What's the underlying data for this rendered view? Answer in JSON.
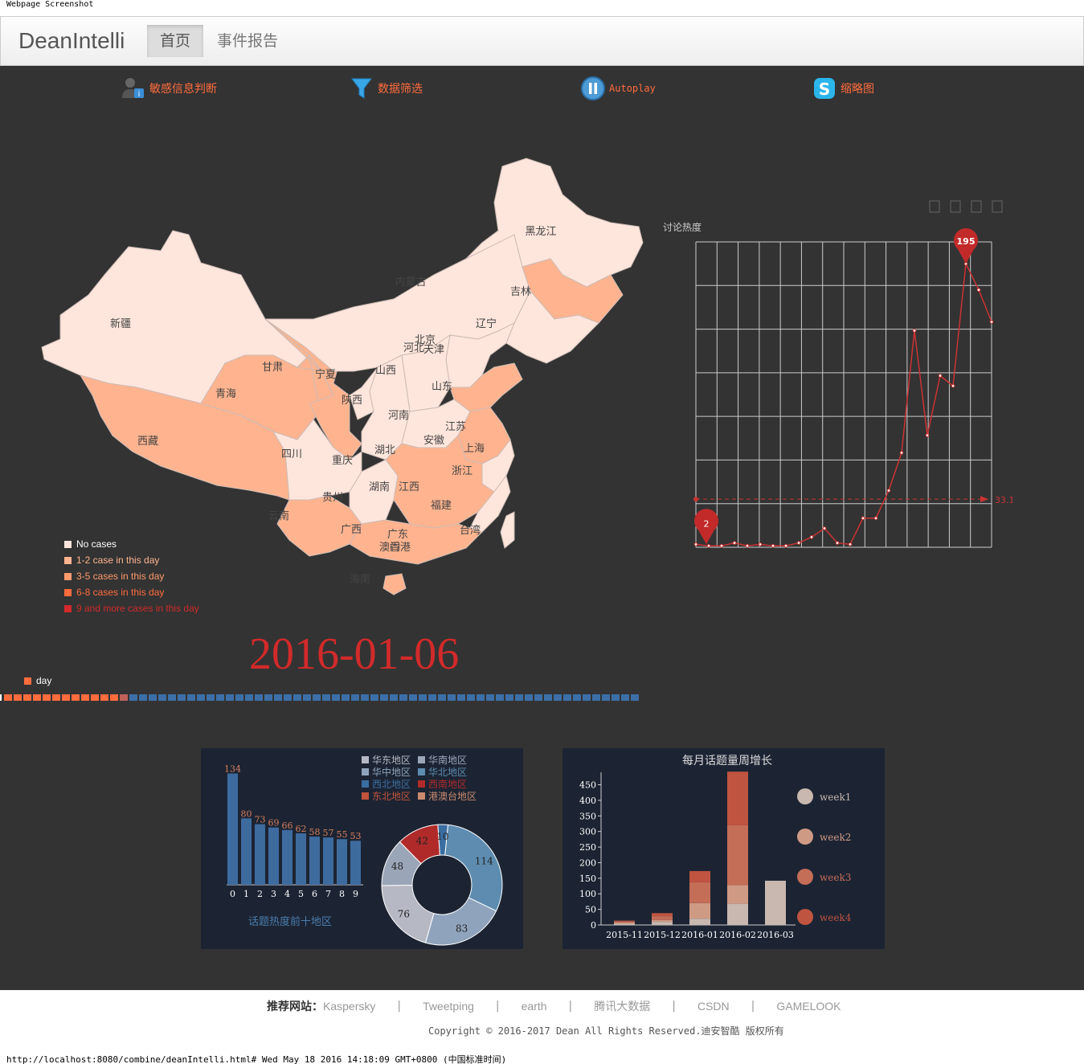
{
  "print_header": "Webpage Screenshot",
  "navbar": {
    "brand": "DeanIntelli",
    "links": [
      "首页",
      "事件报告"
    ]
  },
  "toolbar": [
    {
      "label": "敏感信息判断",
      "icon": "user-info-icon"
    },
    {
      "label": "数据筛选",
      "icon": "filter-icon"
    },
    {
      "label": "Autoplay",
      "icon": "pause-icon"
    },
    {
      "label": "缩略图",
      "icon": "skype-icon"
    }
  ],
  "map": {
    "legend": [
      {
        "label": "No cases",
        "color": "#ffe6dc",
        "text_color": "#ffffff"
      },
      {
        "label": "1-2 case in this day",
        "color": "#ffb48f",
        "text_color": "#ffb48f"
      },
      {
        "label": "3-5 cases in this day",
        "color": "#ff9a6c",
        "text_color": "#ff9a6c"
      },
      {
        "label": "6-8 cases in this day",
        "color": "#ff6c3d",
        "text_color": "#ff6c3d"
      },
      {
        "label": "9 and more cases in this day",
        "color": "#d22a2a",
        "text_color": "#d22a2a"
      }
    ],
    "provinces": [
      "黑龙江",
      "吉林",
      "辽宁",
      "内蒙古",
      "新疆",
      "北京",
      "天津",
      "河北",
      "山西",
      "山东",
      "甘肃",
      "宁夏",
      "陕西",
      "青海",
      "河南",
      "江苏",
      "安徽",
      "上海",
      "西藏",
      "四川",
      "湖北",
      "重庆",
      "浙江",
      "湖南",
      "江西",
      "贵州",
      "福建",
      "云南",
      "广西",
      "广东",
      "台湾",
      "香港",
      "澳门",
      "海南"
    ],
    "date": "2016-01-06"
  },
  "timeline": {
    "legend": "day",
    "played_color": "#ff6c3d",
    "current_color": "#c0625a",
    "remaining_color": "#3c6fa8",
    "played": 12,
    "total": 66
  },
  "line_chart": {
    "title": "讨论热度",
    "toolbox": [
      "data-view-icon",
      "line-icon",
      "bar-icon",
      "restore-icon",
      "save-image-icon"
    ],
    "values": [
      2,
      1,
      1,
      3,
      1,
      2,
      1,
      1,
      3,
      7,
      13,
      3,
      2,
      20,
      20,
      39,
      65,
      149,
      77,
      118,
      111,
      195,
      177,
      155
    ],
    "max_label": "195",
    "min_label": "2",
    "avg_label": "33.11",
    "ylim": [
      0,
      210
    ]
  },
  "bar_panel": {
    "title": "话题热度前十地区",
    "categories": [
      "0",
      "1",
      "2",
      "3",
      "4",
      "5",
      "6",
      "7",
      "8",
      "9"
    ],
    "values": [
      134,
      80,
      73,
      69,
      66,
      62,
      58,
      57,
      55,
      53
    ],
    "legend": [
      {
        "label": "华东地区",
        "color": "#b6b8c4"
      },
      {
        "label": "华南地区",
        "color": "#9aa5b8"
      },
      {
        "label": "华中地区",
        "color": "#8fa4bc"
      },
      {
        "label": "华北地区",
        "color": "#5d8cb0"
      },
      {
        "label": "西北地区",
        "color": "#3b6ea0"
      },
      {
        "label": "西南地区",
        "color": "#b02a2a"
      },
      {
        "label": "东北地区",
        "color": "#c0533b"
      },
      {
        "label": "港澳台地区",
        "color": "#c98a6e"
      }
    ],
    "donut": [
      {
        "value": 114,
        "color": "#5d8cb0"
      },
      {
        "value": 83,
        "color": "#8fa4bc"
      },
      {
        "value": 76,
        "color": "#b6b8c4"
      },
      {
        "value": 48,
        "color": "#9aa5b8"
      },
      {
        "value": 42,
        "color": "#b02a2a"
      },
      {
        "value": 10,
        "color": "#3b6ea0"
      }
    ]
  },
  "stack_panel": {
    "title": "每月话题量周增长",
    "categories": [
      "2015-11",
      "2015-12",
      "2016-01",
      "2016-02",
      "2016-03"
    ],
    "y_ticks": [
      "0",
      "50",
      "100",
      "150",
      "200",
      "250",
      "300",
      "350",
      "400",
      "450"
    ],
    "ylim": [
      0,
      490
    ],
    "series": [
      {
        "name": "week1",
        "color": "#c8b8b0",
        "values": [
          4,
          10,
          20,
          68,
          142
        ]
      },
      {
        "name": "week2",
        "color": "#cf9a84",
        "values": [
          4,
          6,
          50,
          60,
          0
        ]
      },
      {
        "name": "week3",
        "color": "#c46d57",
        "values": [
          4,
          12,
          67,
          192,
          0
        ]
      },
      {
        "name": "week4",
        "color": "#bf5440",
        "values": [
          2,
          10,
          36,
          172,
          0
        ]
      }
    ]
  },
  "footer": {
    "label": "推荐网站：",
    "links": [
      "Kaspersky",
      "Tweetping",
      "earth",
      "腾讯大数据",
      "CSDN",
      "GAMELOOK"
    ],
    "copyright": "Copyright © 2016-2017 Dean All Rights Reserved.迪安智酷 版权所有",
    "url_line": "http://localhost:8080/combine/deanIntelli.html# Wed May 18 2016 14:18:09 GMT+0800 (中国标准时间)"
  }
}
